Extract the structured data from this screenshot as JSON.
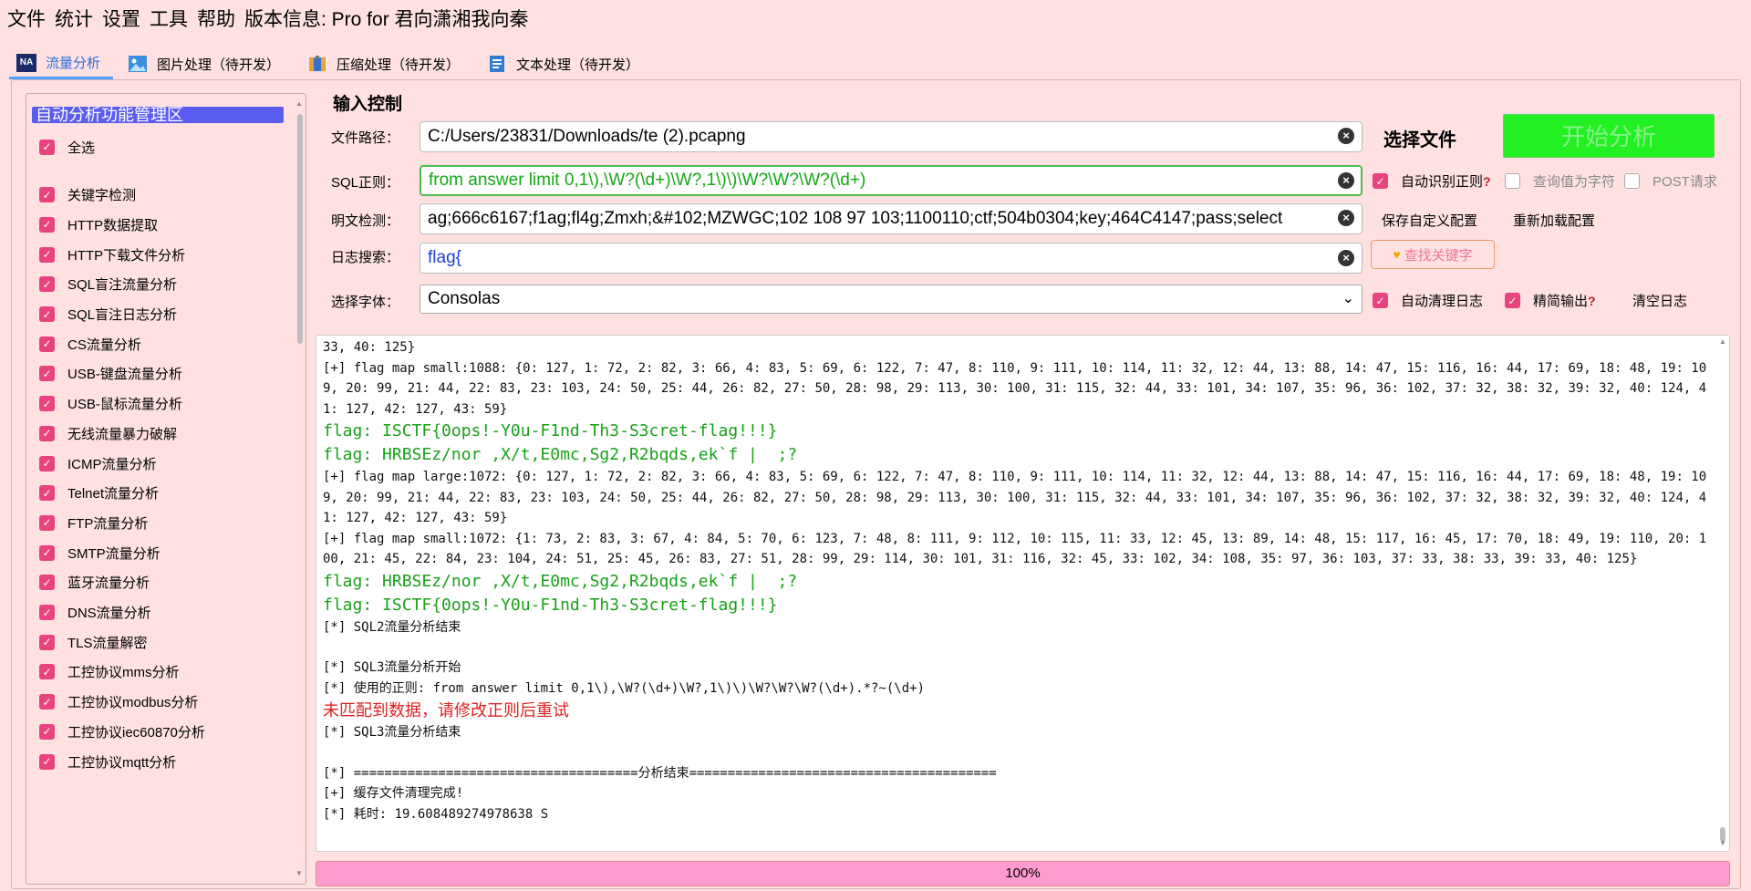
{
  "menu": {
    "items": [
      "文件",
      "统计",
      "设置",
      "工具",
      "帮助"
    ],
    "version_label": "版本信息: Pro for 君向潇湘我向秦"
  },
  "tabs": [
    {
      "label": "流量分析",
      "icon": "na-icon",
      "active": true
    },
    {
      "label": "图片处理（待开发）",
      "icon": "image-icon",
      "active": false
    },
    {
      "label": "压缩处理（待开发）",
      "icon": "archive-icon",
      "active": false
    },
    {
      "label": "文本处理（待开发）",
      "icon": "document-icon",
      "active": false
    }
  ],
  "left_panel": {
    "header": "自动分析功能管理区",
    "items": [
      {
        "label": "全选",
        "checked": true
      },
      {
        "label": "关键字检测",
        "checked": true
      },
      {
        "label": "HTTP数据提取",
        "checked": true
      },
      {
        "label": "HTTP下载文件分析",
        "checked": true
      },
      {
        "label": "SQL盲注流量分析",
        "checked": true
      },
      {
        "label": "SQL盲注日志分析",
        "checked": true
      },
      {
        "label": "CS流量分析",
        "checked": true
      },
      {
        "label": "USB-键盘流量分析",
        "checked": true
      },
      {
        "label": "USB-鼠标流量分析",
        "checked": true
      },
      {
        "label": "无线流量暴力破解",
        "checked": true
      },
      {
        "label": "ICMP流量分析",
        "checked": true
      },
      {
        "label": "Telnet流量分析",
        "checked": true
      },
      {
        "label": "FTP流量分析",
        "checked": true
      },
      {
        "label": "SMTP流量分析",
        "checked": true
      },
      {
        "label": "蓝牙流量分析",
        "checked": true
      },
      {
        "label": "DNS流量分析",
        "checked": true
      },
      {
        "label": "TLS流量解密",
        "checked": true
      },
      {
        "label": "工控协议mms分析",
        "checked": true
      },
      {
        "label": "工控协议modbus分析",
        "checked": true
      },
      {
        "label": "工控协议iec60870分析",
        "checked": true
      },
      {
        "label": "工控协议mqtt分析",
        "checked": true
      }
    ]
  },
  "input_control": {
    "title": "输入控制",
    "file_path_label": "文件路径：",
    "file_path_value": "C:/Users/23831/Downloads/te (2).pcapng",
    "sql_regex_label": "SQL正则：",
    "sql_regex_value": "from answer limit 0,1\\),\\W?(\\d+)\\W?,1\\)\\)\\W?\\W?\\W?(\\d+)",
    "plaintext_label": "明文检测：",
    "plaintext_value": "ag;666c6167;f1ag;fl4g;Zmxh;&#102;MZWGC;102 108 97 103;1100110;ctf;504b0304;key;464C4147;pass;select",
    "log_search_label": "日志搜索：",
    "log_search_value": "flag{",
    "font_label": "选择字体：",
    "font_value": "Consolas",
    "choose_file": "选择文件",
    "start_button": "开始分析",
    "auto_regex": "自动识别正则",
    "query_as_string": "查询值为字符",
    "post_request": "POST请求",
    "save_config": "保存自定义配置",
    "reload_config": "重新加载配置",
    "find_keyword": "查找关键字",
    "auto_clear_log": "自动清理日志",
    "concise_output": "精简输出",
    "clear_log": "清空日志",
    "question_mark": "?"
  },
  "log": [
    {
      "type": "normal",
      "text": "33, 40: 125}"
    },
    {
      "type": "normal",
      "text": "[+] flag map small:1088: {0: 127, 1: 72, 2: 82, 3: 66, 4: 83, 5: 69, 6: 122, 7: 47, 8: 110, 9: 111, 10: 114, 11: 32, 12: 44, 13: 88, 14: 47, 15: 116, 16: 44, 17: 69, 18: 48, 19: 109, 20: 99, 21: 44, 22: 83, 23: 103, 24: 50, 25: 44, 26: 82, 27: 50, 28: 98, 29: 113, 30: 100, 31: 115, 32: 44, 33: 101, 34: 107, 35: 96, 36: 102, 37: 32, 38: 32, 39: 32, 40: 124, 41: 127, 42: 127, 43: 59}"
    },
    {
      "type": "flag",
      "text": "flag: ISCTF{0ops!-Y0u-F1nd-Th3-S3cret-flag!!!}"
    },
    {
      "type": "flag",
      "text": "flag: HRBSEz/nor ,X/t,E0mc,Sg2,R2bqds,ek`f |  ;?"
    },
    {
      "type": "normal",
      "text": "[+] flag map large:1072: {0: 127, 1: 72, 2: 82, 3: 66, 4: 83, 5: 69, 6: 122, 7: 47, 8: 110, 9: 111, 10: 114, 11: 32, 12: 44, 13: 88, 14: 47, 15: 116, 16: 44, 17: 69, 18: 48, 19: 109, 20: 99, 21: 44, 22: 83, 23: 103, 24: 50, 25: 44, 26: 82, 27: 50, 28: 98, 29: 113, 30: 100, 31: 115, 32: 44, 33: 101, 34: 107, 35: 96, 36: 102, 37: 32, 38: 32, 39: 32, 40: 124, 41: 127, 42: 127, 43: 59}"
    },
    {
      "type": "normal",
      "text": "[+] flag map small:1072: {1: 73, 2: 83, 3: 67, 4: 84, 5: 70, 6: 123, 7: 48, 8: 111, 9: 112, 10: 115, 11: 33, 12: 45, 13: 89, 14: 48, 15: 117, 16: 45, 17: 70, 18: 49, 19: 110, 20: 100, 21: 45, 22: 84, 23: 104, 24: 51, 25: 45, 26: 83, 27: 51, 28: 99, 29: 114, 30: 101, 31: 116, 32: 45, 33: 102, 34: 108, 35: 97, 36: 103, 37: 33, 38: 33, 39: 33, 40: 125}"
    },
    {
      "type": "flag",
      "text": "flag: HRBSEz/nor ,X/t,E0mc,Sg2,R2bqds,ek`f |  ;?"
    },
    {
      "type": "flag",
      "text": "flag: ISCTF{0ops!-Y0u-F1nd-Th3-S3cret-flag!!!}"
    },
    {
      "type": "normal",
      "text": "[*] SQL2流量分析结束"
    },
    {
      "type": "blank",
      "text": ""
    },
    {
      "type": "normal",
      "text": "[*] SQL3流量分析开始"
    },
    {
      "type": "normal",
      "text": "[*] 使用的正则: from answer limit 0,1\\),\\W?(\\d+)\\W?,1\\)\\)\\W?\\W?\\W?(\\d+).*?~(\\d+)"
    },
    {
      "type": "err",
      "text": "未匹配到数据，请修改正则后重试"
    },
    {
      "type": "normal",
      "text": "[*] SQL3流量分析结束"
    },
    {
      "type": "blank",
      "text": ""
    },
    {
      "type": "normal",
      "text": "[*] =====================================分析结束========================================"
    },
    {
      "type": "normal",
      "text": "[+] 缓存文件清理完成!"
    },
    {
      "type": "normal",
      "text": "[*] 耗时: 19.608489274978638 S"
    }
  ],
  "progress": {
    "value": 1.0,
    "label": "100%"
  },
  "colors": {
    "background": "#ffe1e1",
    "accent_pink": "#e8437e",
    "start_green": "#23f023",
    "flag_green": "#18a118",
    "error_red": "#e02020"
  }
}
